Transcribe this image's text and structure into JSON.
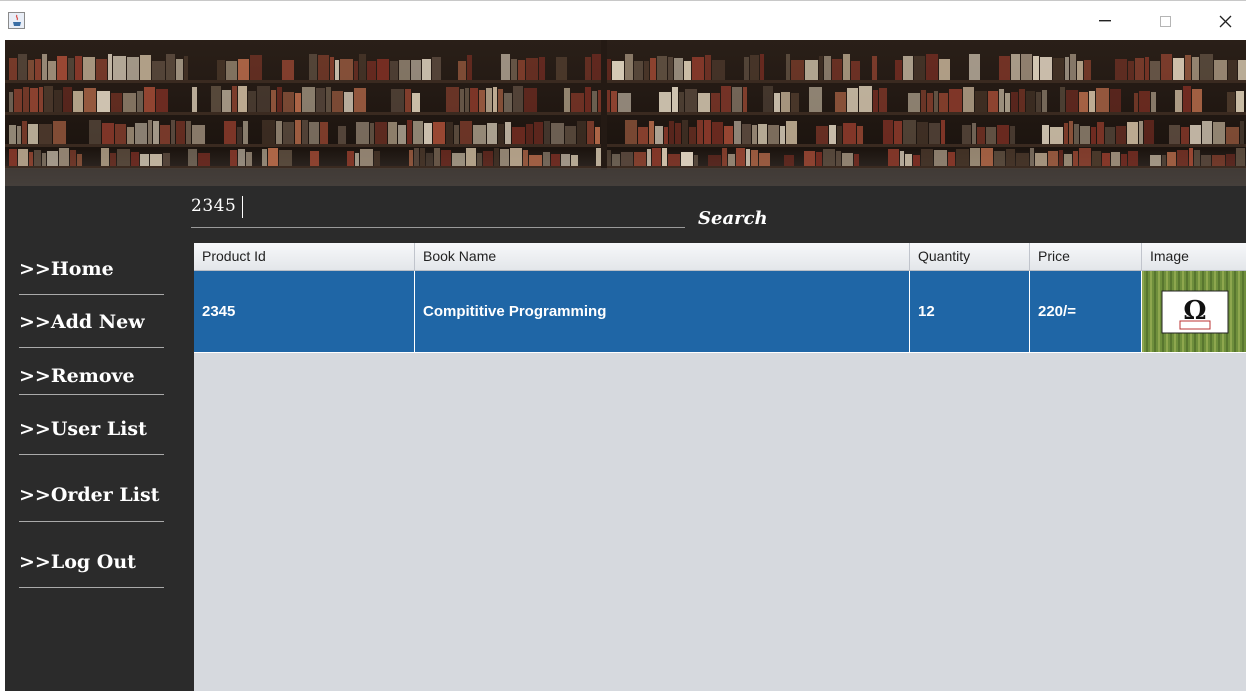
{
  "window": {
    "icon": "java-app-icon",
    "controls": [
      "minimize-icon",
      "maximize-icon",
      "close-icon"
    ]
  },
  "search": {
    "value": "2345",
    "label": "Search"
  },
  "sidebar": {
    "items": [
      {
        "label": ">>Home"
      },
      {
        "label": ">>Add New"
      },
      {
        "label": ">>Remove"
      },
      {
        "label": ">>User List"
      },
      {
        "label": ">>Order List"
      },
      {
        "label": ">>Log Out"
      }
    ]
  },
  "table": {
    "headers": [
      "Product Id",
      "Book Name",
      "Quantity",
      "Price",
      "Image"
    ],
    "rows": [
      {
        "product_id": "2345",
        "book_name": "Compititive Programming",
        "quantity": "12",
        "price": "220/=",
        "image": "book-cover-thumbnail"
      }
    ]
  },
  "colors": {
    "sidebar_bg": "#2b2b2b",
    "table_bg": "#d6d9de",
    "selected_row": "#1f66a6"
  }
}
